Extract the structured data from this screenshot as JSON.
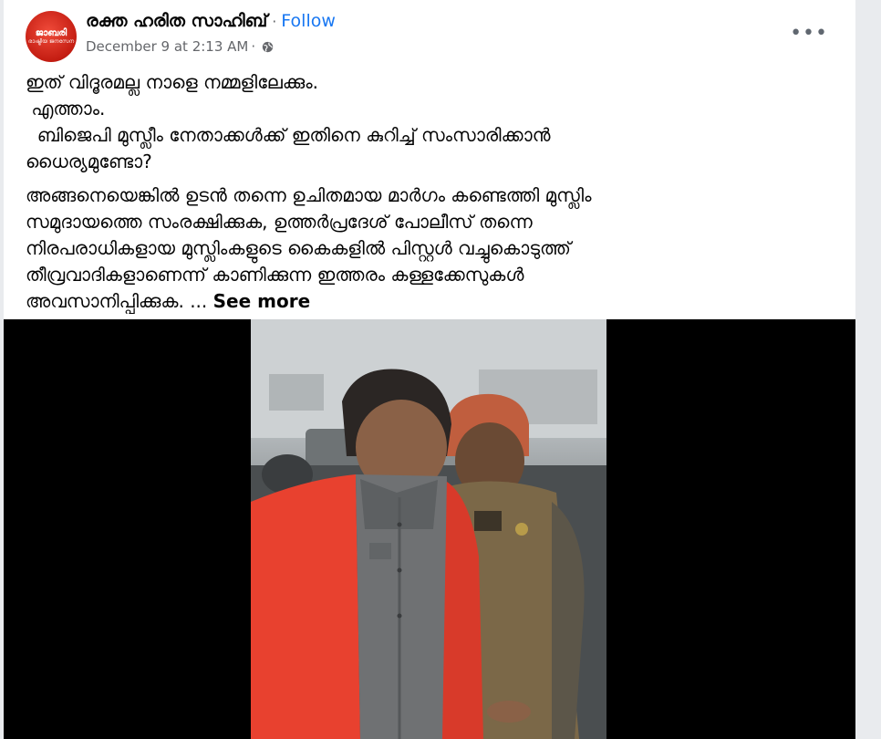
{
  "post": {
    "page_name": "രക്ത ഹരിത സാഹിബ്",
    "follow_label": "Follow",
    "separator": "·",
    "timestamp": "December 9 at 2:13 AM",
    "meta_separator": "·",
    "privacy_icon": "globe-icon",
    "more_label": "•••",
    "avatar": {
      "line1": "ജാബരി",
      "line2": "രാഷ്ട്രീയ ജനസേന"
    },
    "paragraph1": "ഇത് വിദൂരമല്ല നാളെ നമ്മളിലേക്കും.\n എത്താം.\n  ബിജെപി മുസ്ലീം നേതാക്കൾക്ക് ഇതിനെ കുറിച്ച് സംസാരിക്കാൻ\nധൈര്യമുണ്ടോ?",
    "paragraph2": "അങ്ങനെയെങ്കിൽ ഉടൻ തന്നെ ഉചിതമായ മാർഗം കണ്ടെത്തി മുസ്ലിം\nസമുദായത്തെ സംരക്ഷിക്കുക, ഉത്തർപ്രദേശ് പോലീസ് തന്നെ\nനിരപരാധികളായ മുസ്ലിംകളുടെ കൈകളിൽ പിസ്റ്റൾ വച്ചുകൊടുത്ത്\nതീവ്രവാദികളാണെന്ന് കാണിക്കുന്ന ഇത്തരം കള്ളക്കേസുകൾ\nഅവസാനിപ്പിക്കുക. ...",
    "see_more_label": "See more"
  },
  "colors": {
    "accent": "#1877f2",
    "muted_text": "#65676b",
    "background": "#e9ebee",
    "avatar_red": "#c41d12",
    "jacket_red": "#e8412f"
  }
}
